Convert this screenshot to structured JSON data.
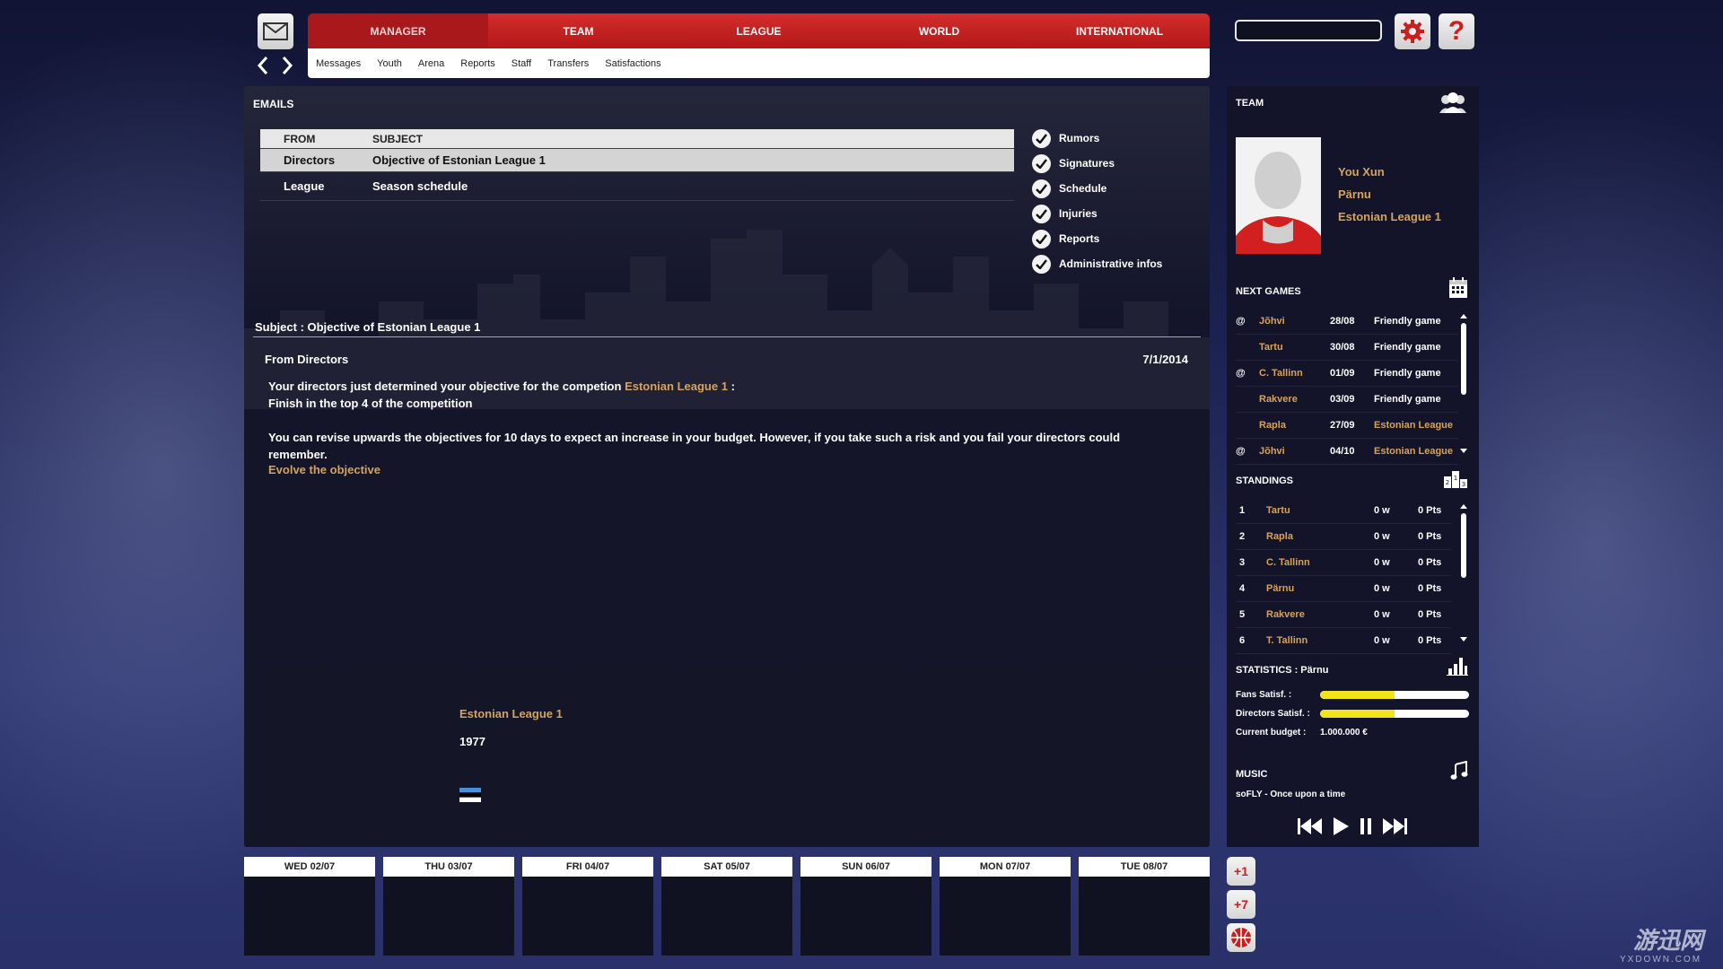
{
  "nav": {
    "tabs": [
      "MANAGER",
      "TEAM",
      "LEAGUE",
      "WORLD",
      "INTERNATIONAL"
    ],
    "active_tab": "MANAGER",
    "subtabs": [
      "Messages",
      "Youth",
      "Arena",
      "Reports",
      "Staff",
      "Transfers",
      "Satisfactions"
    ],
    "search_value": ""
  },
  "emails": {
    "title": "EMAILS",
    "columns": {
      "from": "FROM",
      "subject": "SUBJECT"
    },
    "rows": [
      {
        "from": "Directors",
        "subject": "Objective of Estonian League 1",
        "selected": true
      },
      {
        "from": "League",
        "subject": "Season schedule",
        "selected": false
      }
    ]
  },
  "filters": [
    {
      "label": "Rumors",
      "checked": true
    },
    {
      "label": "Signatures",
      "checked": true
    },
    {
      "label": "Schedule",
      "checked": true
    },
    {
      "label": "Injuries",
      "checked": true
    },
    {
      "label": "Reports",
      "checked": true
    },
    {
      "label": "Administrative infos",
      "checked": true
    }
  ],
  "message": {
    "subject": "Subject : Objective of Estonian League 1",
    "from": "From Directors",
    "date": "7/1/2014",
    "line1_prefix": "Your directors just determined your objective for the competion",
    "line1_link": "Estonian League 1",
    "line1_suffix": ":",
    "line2": "Finish in the top 4 of the competition",
    "line3": "You can revise upwards the objectives for 10 days to expect an increase in your budget. However, if you take such a risk and you fail your directors could remember.",
    "action": "Evolve the objective",
    "competition_name": "Estonian League 1",
    "competition_year": "1977"
  },
  "calendar": [
    "WED 02/07",
    "THU 03/07",
    "FRI 04/07",
    "SAT 05/07",
    "SUN 06/07",
    "MON 07/07",
    "TUE 08/07"
  ],
  "side_buttons": {
    "plus1": "+1",
    "plus7": "+7"
  },
  "team": {
    "title": "TEAM",
    "manager": "You Xun",
    "club": "Pärnu",
    "league": "Estonian League 1"
  },
  "next_games": {
    "title": "NEXT GAMES",
    "rows": [
      {
        "at": "@",
        "team": "Jõhvi",
        "date": "28/08",
        "type": "Friendly game",
        "comp": false
      },
      {
        "at": "",
        "team": "Tartu",
        "date": "30/08",
        "type": "Friendly game",
        "comp": false
      },
      {
        "at": "@",
        "team": "C. Tallinn",
        "date": "01/09",
        "type": "Friendly game",
        "comp": false
      },
      {
        "at": "",
        "team": "Rakvere",
        "date": "03/09",
        "type": "Friendly game",
        "comp": false
      },
      {
        "at": "",
        "team": "Rapla",
        "date": "27/09",
        "type": "Estonian League",
        "comp": true
      },
      {
        "at": "@",
        "team": "Jõhvi",
        "date": "04/10",
        "type": "Estonian League",
        "comp": true
      }
    ]
  },
  "standings": {
    "title": "STANDINGS",
    "rows": [
      {
        "pos": "1",
        "team": "Tartu",
        "w": "0 w",
        "pts": "0 Pts"
      },
      {
        "pos": "2",
        "team": "Rapla",
        "w": "0 w",
        "pts": "0 Pts"
      },
      {
        "pos": "3",
        "team": "C. Tallinn",
        "w": "0 w",
        "pts": "0 Pts"
      },
      {
        "pos": "4",
        "team": "Pärnu",
        "w": "0 w",
        "pts": "0 Pts"
      },
      {
        "pos": "5",
        "team": "Rakvere",
        "w": "0 w",
        "pts": "0 Pts"
      },
      {
        "pos": "6",
        "team": "T. Tallinn",
        "w": "0 w",
        "pts": "0 Pts"
      }
    ]
  },
  "statistics": {
    "title": "STATISTICS : Pärnu",
    "fans_label": "Fans Satisf. :",
    "fans_level": 0.5,
    "directors_label": "Directors Satisf. :",
    "directors_level": 0.5,
    "budget_label": "Current budget :",
    "budget_value": "1.000.000 €"
  },
  "music": {
    "title": "MUSIC",
    "track": "soFLY - Once upon a time"
  },
  "colors": {
    "accent_red": "#c91f1f",
    "gold_text": "#d6a35a",
    "satisfaction_yellow": "#f1e41c"
  },
  "icons": [
    "mail-icon",
    "chevron-left-icon",
    "chevron-right-icon",
    "gear-icon",
    "question-icon",
    "checkmark-icon",
    "user-group-icon",
    "calendar-icon",
    "podium-icon",
    "bar-chart-icon",
    "music-note-icon",
    "skip-back-icon",
    "play-icon",
    "pause-icon",
    "skip-forward-icon",
    "basketball-icon",
    "estonia-flag-icon"
  ],
  "watermark": {
    "text": "游迅网",
    "sub": "YXDOWN.COM"
  }
}
